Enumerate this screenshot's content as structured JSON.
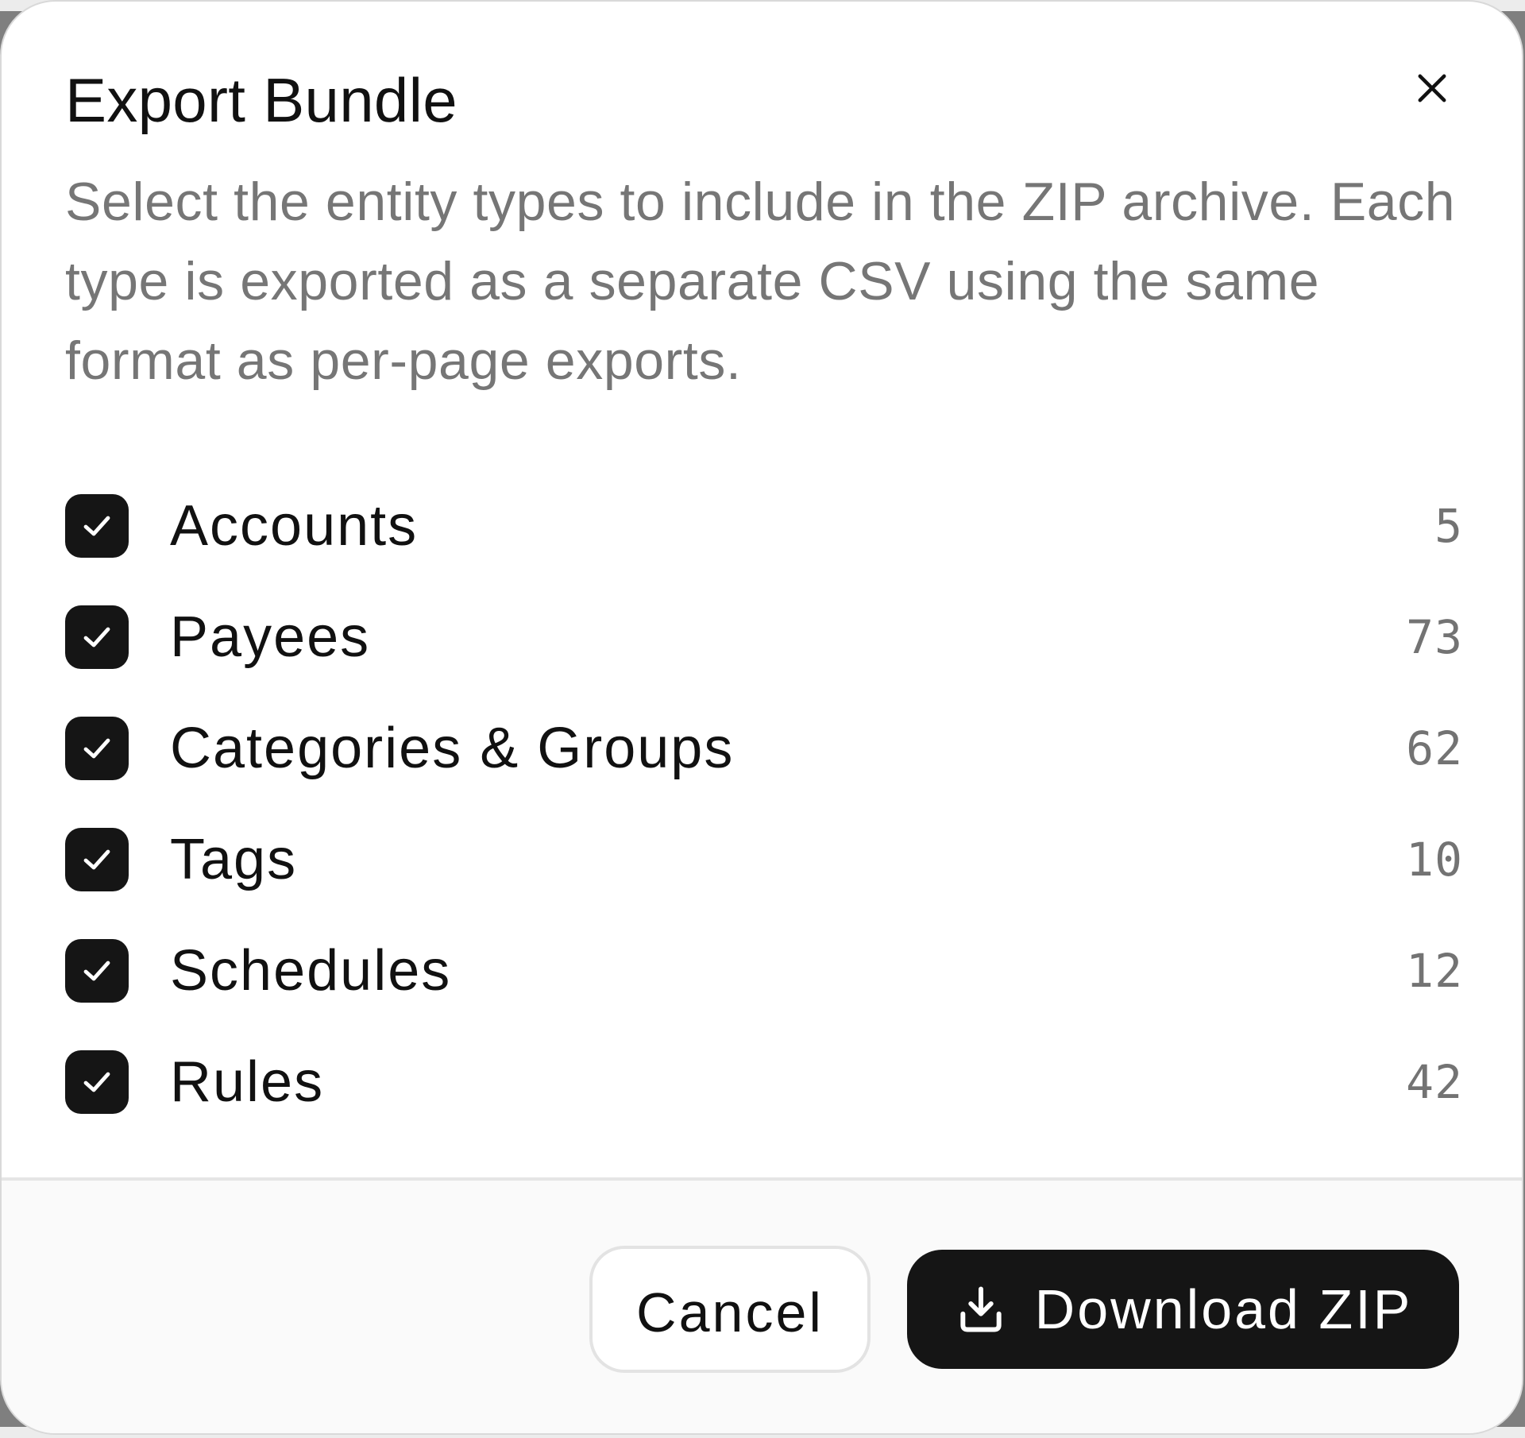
{
  "dialog": {
    "title": "Export Bundle",
    "description": "Select the entity types to include in the ZIP archive. Each type is exported as a separate CSV using the same format as per-page exports.",
    "close_icon": "close-icon",
    "entities": [
      {
        "label": "Accounts",
        "count": "5",
        "checked": true
      },
      {
        "label": "Payees",
        "count": "73",
        "checked": true
      },
      {
        "label": "Categories & Groups",
        "count": "62",
        "checked": true
      },
      {
        "label": "Tags",
        "count": "10",
        "checked": true
      },
      {
        "label": "Schedules",
        "count": "12",
        "checked": true
      },
      {
        "label": "Rules",
        "count": "42",
        "checked": true
      }
    ],
    "footer": {
      "cancel_label": "Cancel",
      "download_label": "Download ZIP",
      "download_icon": "download-icon"
    }
  },
  "colors": {
    "primary": "#151515",
    "text": "#111111",
    "muted_text": "#767676",
    "border": "#e3e3e3",
    "footer_background": "#fafafa"
  }
}
